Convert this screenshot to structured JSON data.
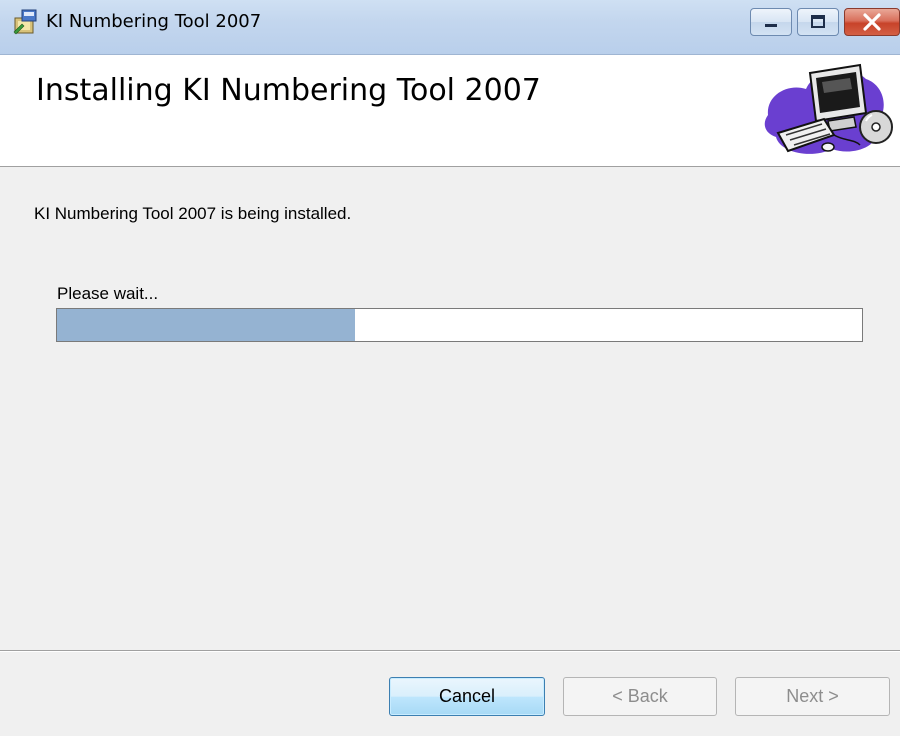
{
  "window": {
    "title": "KI Numbering Tool 2007",
    "controls": {
      "minimize_icon": "minimize-icon",
      "maximize_icon": "maximize-icon",
      "close_icon": "close-icon"
    }
  },
  "header": {
    "title": "Installing KI Numbering Tool 2007",
    "art_icon": "computer-setup-icon"
  },
  "main": {
    "status_text": "KI Numbering Tool 2007 is being installed.",
    "wait_label": "Please wait...",
    "progress_fraction": 0.37
  },
  "footer": {
    "cancel_label": "Cancel",
    "back_label": "< Back",
    "next_label": "Next >"
  },
  "colors": {
    "progress_fill": "#95b3d2",
    "titlebar": "#c3d6ee",
    "close_button": "#c8432a",
    "default_button_border": "#3c7fb1"
  }
}
